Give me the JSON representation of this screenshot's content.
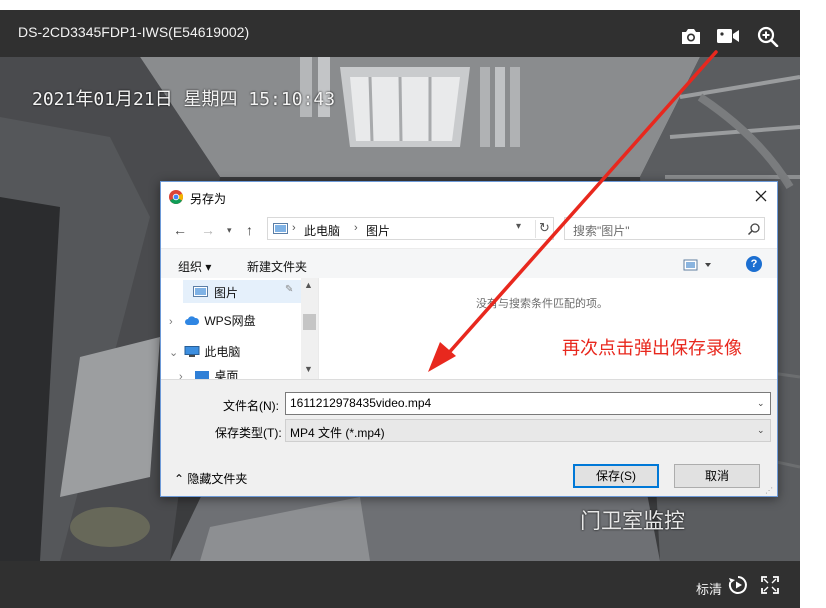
{
  "player": {
    "camera_title": "DS-2CD3345FDP1-IWS(E54619002)",
    "osd_datetime": "2021年01月21日 星期四 15:10:43",
    "osd_location": "门卫室监控",
    "quality_label": "标清",
    "icons": [
      "camera-icon",
      "video-record-icon",
      "zoom-in-icon",
      "playback-icon",
      "fullscreen-icon"
    ]
  },
  "dialog": {
    "title": "另存为",
    "breadcrumb": [
      "此电脑",
      "图片"
    ],
    "search_placeholder": "搜索\"图片\"",
    "organize_label": "组织 ▾",
    "new_folder_label": "新建文件夹",
    "help_label": "?",
    "nav_items": [
      {
        "label": "图片",
        "selected": true
      },
      {
        "label": "WPS网盘"
      },
      {
        "label": "此电脑"
      },
      {
        "label": "桌面"
      }
    ],
    "empty_message": "没有与搜索条件匹配的项。",
    "filename_label": "文件名(N):",
    "filename_value": "1611212978435video.mp4",
    "filetype_label": "保存类型(T):",
    "filetype_value": "MP4 文件 (*.mp4)",
    "hide_folders_label": "隐藏文件夹",
    "save_label": "保存(S)",
    "cancel_label": "取消"
  },
  "annotation": {
    "text": "再次点击弹出保存录像",
    "color": "#e8281e"
  }
}
